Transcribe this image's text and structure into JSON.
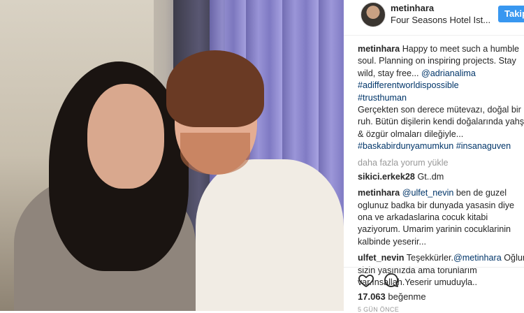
{
  "header": {
    "username": "metinhara",
    "location": "Four Seasons Hotel Ist...",
    "follow_label": "Takip"
  },
  "caption": {
    "username": "metinhara",
    "line1": "Happy to meet such a humble",
    "line2": "soul. Planning on inspiring projects. Stay",
    "line3_text": "wild, stay free...",
    "line3_mention": "@adrianalima",
    "hashtag1": "#adifferentworldispossible",
    "hashtag2": "#trusthuman",
    "tr_line1": "Gerçekten son derece mütevazı, doğal bir",
    "tr_line2": "ruh. Bütün dişilerin kendi doğalarında yahşi",
    "tr_line3": "& özgür olmaları dileğiyle...",
    "hashtag3": "#baskabirdunyamumkun",
    "hashtag4": "#insanaguven"
  },
  "load_more": "daha fazla yorum yükle",
  "comments": [
    {
      "username": "sikici.erkek28",
      "text": "Gt..dm"
    },
    {
      "username": "metinhara",
      "mention": "@ulfet_nevin",
      "l1": "ben de guzel",
      "l2": "oglunuz badka bir dunyada yasasin diye",
      "l3": "ona ve arkadaslarina cocuk kitabi",
      "l4": "yaziyorum. Umarim yarinin cocuklarinin",
      "l5": "kalbinde yeserir..."
    },
    {
      "username": "ulfet_nevin",
      "text_start": "Teşekkürler.",
      "mention": "@metinhara",
      "text_end": "Oğlum",
      "l2": "sizin yaşınızda ama torunlarım",
      "l3": "var.İnsallah.Yeserir umuduyla.."
    }
  ],
  "likes": {
    "count": "17.063",
    "label": "beğenme"
  },
  "time_ago": "5 GÜN ÖNCE"
}
